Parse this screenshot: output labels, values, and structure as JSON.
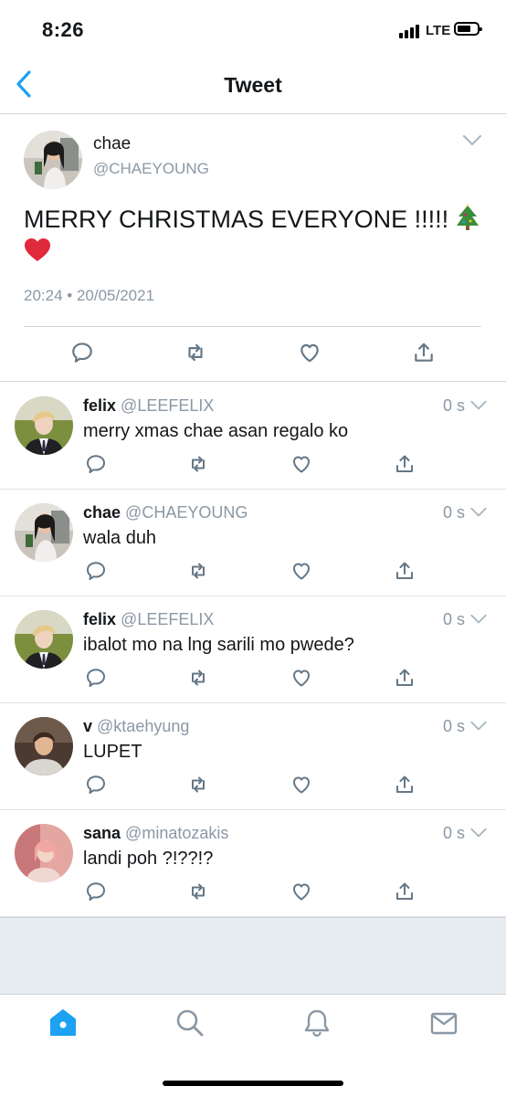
{
  "status_bar": {
    "time": "8:26",
    "network": "LTE"
  },
  "nav": {
    "title": "Tweet",
    "back_icon": "chevron-left-icon"
  },
  "main_tweet": {
    "name": "chae",
    "handle": "@CHAEYOUNG",
    "text": "MERRY CHRISTMAS EVERYONE !!!!!",
    "emojis": [
      "christmas-tree",
      "red-heart"
    ],
    "timestamp": "20:24 • 20/05/2021"
  },
  "replies": [
    {
      "name": "felix",
      "handle": "@LEEFELIX",
      "time": "0 s",
      "text": "merry xmas chae asan regalo ko"
    },
    {
      "name": "chae",
      "handle": "@CHAEYOUNG",
      "time": "0 s",
      "text": "wala duh"
    },
    {
      "name": "felix",
      "handle": "@LEEFELIX",
      "time": "0 s",
      "text": "ibalot mo na lng sarili mo pwede?"
    },
    {
      "name": "v",
      "handle": "@ktaehyung",
      "time": "0 s",
      "text": "LUPET"
    },
    {
      "name": "sana",
      "handle": "@minatozakis",
      "time": "0 s",
      "text": "landi poh ?!??!?"
    }
  ],
  "tab_bar": [
    "home-icon",
    "search-icon",
    "notifications-icon",
    "messages-icon"
  ],
  "colors": {
    "accent": "#1da1f2",
    "icon_gray": "#8b98a5",
    "divider": "#cfd4d8",
    "empty_area": "#e6ecf0"
  }
}
